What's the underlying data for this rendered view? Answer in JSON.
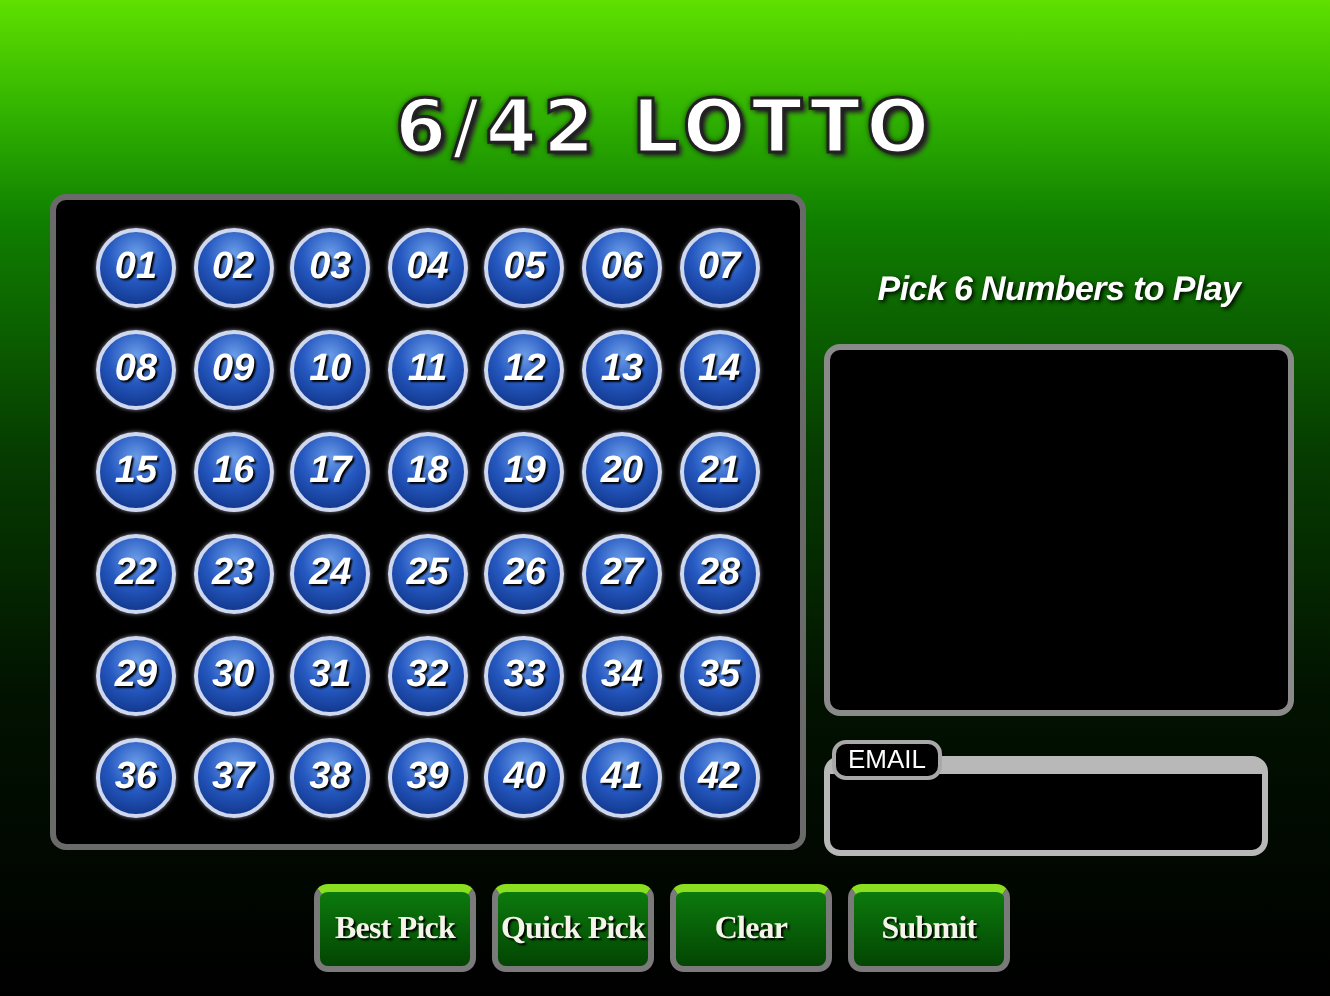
{
  "title": "6/42 LOTTO",
  "numbers": [
    "01",
    "02",
    "03",
    "04",
    "05",
    "06",
    "07",
    "08",
    "09",
    "10",
    "11",
    "12",
    "13",
    "14",
    "15",
    "16",
    "17",
    "18",
    "19",
    "20",
    "21",
    "22",
    "23",
    "24",
    "25",
    "26",
    "27",
    "28",
    "29",
    "30",
    "31",
    "32",
    "33",
    "34",
    "35",
    "36",
    "37",
    "38",
    "39",
    "40",
    "41",
    "42"
  ],
  "pick_prompt": "Pick 6 Numbers to Play",
  "email": {
    "label": "EMAIL"
  },
  "buttons": [
    "Best Pick",
    "Quick Pick",
    "Clear",
    "Submit"
  ]
}
